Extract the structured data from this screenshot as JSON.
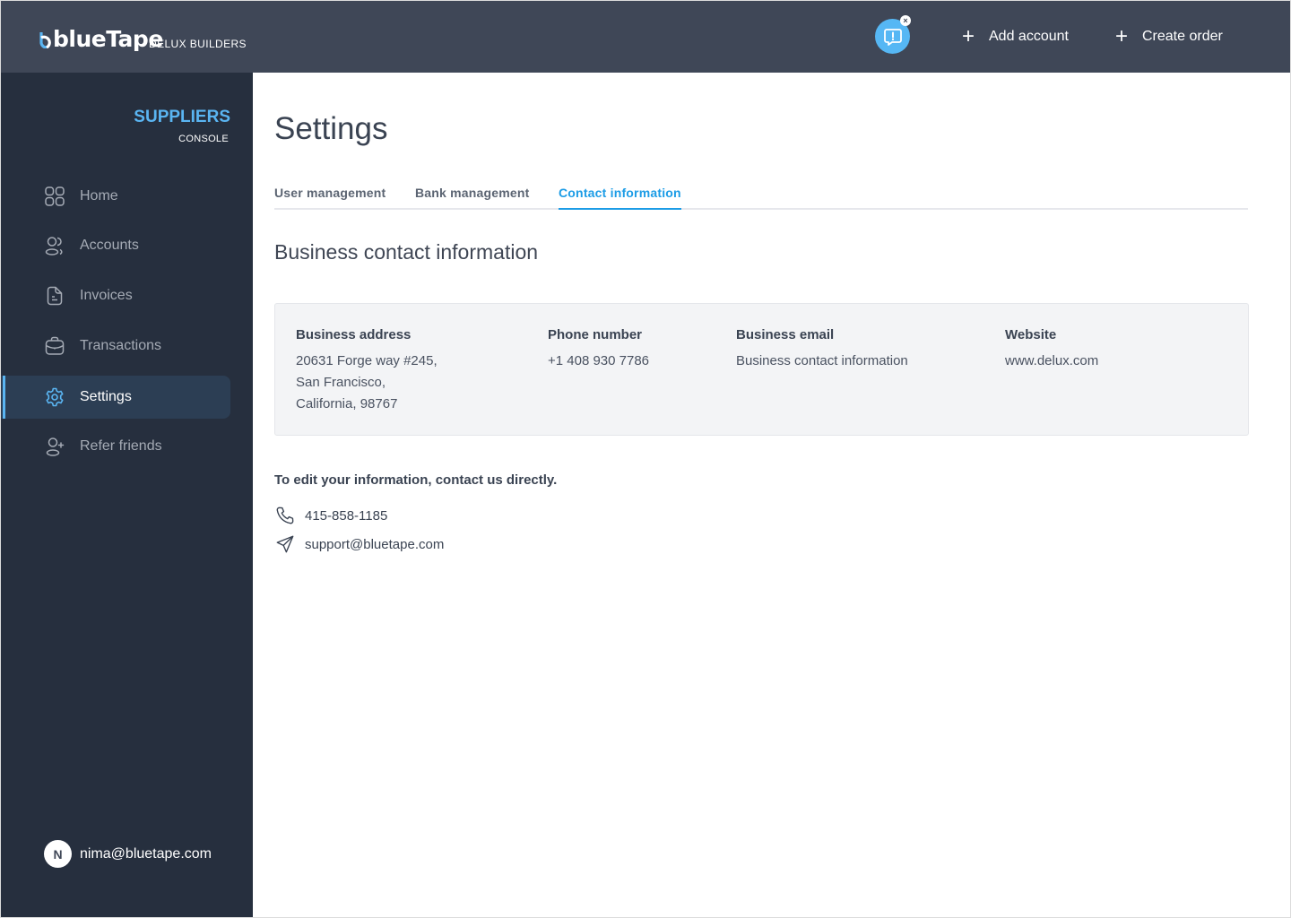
{
  "header": {
    "logo_text": "blueTape",
    "company_name": "DELUX BUILDERS",
    "notification_icon": "chat-alert-icon",
    "notification_dismiss": "×",
    "actions": [
      {
        "label": "Add account",
        "icon": "plus-icon"
      },
      {
        "label": "Create order",
        "icon": "plus-icon"
      }
    ]
  },
  "sidebar": {
    "title": "SUPPLIERS",
    "subtitle": "CONSOLE",
    "items": [
      {
        "label": "Home",
        "icon": "grid-icon",
        "active": false
      },
      {
        "label": "Accounts",
        "icon": "users-icon",
        "active": false
      },
      {
        "label": "Invoices",
        "icon": "document-icon",
        "active": false
      },
      {
        "label": "Transactions",
        "icon": "briefcase-icon",
        "active": false
      },
      {
        "label": "Settings",
        "icon": "gear-icon",
        "active": true
      },
      {
        "label": "Refer friends",
        "icon": "user-plus-icon",
        "active": false
      }
    ],
    "user": {
      "initial": "N",
      "email": "nima@bluetape.com"
    }
  },
  "colors": {
    "topbar": "#3f4757",
    "sidebar": "#262f3e",
    "accent": "#5ab5f2",
    "tab_active": "#1c9ce6"
  },
  "main": {
    "title": "Settings",
    "tabs": [
      {
        "label": "User management",
        "active": false
      },
      {
        "label": "Bank management",
        "active": false
      },
      {
        "label": "Contact information",
        "active": true
      }
    ],
    "section_title": "Business contact information",
    "info": {
      "address": {
        "label": "Business address",
        "lines": [
          "20631 Forge way #245,",
          "San Francisco,",
          "California, 98767"
        ]
      },
      "phone": {
        "label": "Phone number",
        "value": "+1 408 930 7786"
      },
      "email": {
        "label": "Business email",
        "value": "Business contact information"
      },
      "website": {
        "label": "Website",
        "value": "www.delux.com"
      }
    },
    "edit_note": "To edit your information, contact us directly.",
    "support": {
      "phone": "415-858-1185",
      "email": "support@bluetape.com"
    }
  }
}
